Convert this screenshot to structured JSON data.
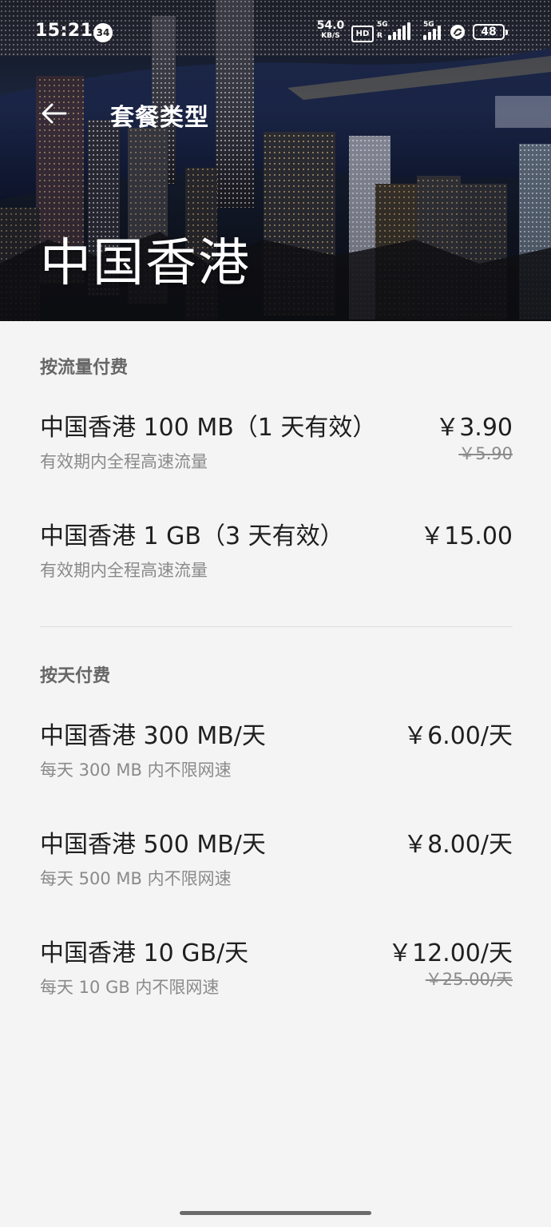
{
  "status_bar": {
    "time": "15:21",
    "notification_count": "34",
    "net_speed_value": "54.0",
    "net_speed_unit": "KB/S",
    "hd_label": "HD",
    "sim1_network": "5G",
    "sim1_roaming": "R",
    "sim2_network": "5G",
    "battery_level": "48"
  },
  "header": {
    "back_icon": "arrow-left-icon",
    "title": "套餐类型",
    "region": "中国香港"
  },
  "sections": [
    {
      "title": "按流量付费",
      "plans": [
        {
          "name": "中国香港 100 MB（1 天有效）",
          "description": "有效期内全程高速流量",
          "price": "￥3.90",
          "original_price": "￥5.90"
        },
        {
          "name": "中国香港 1 GB（3 天有效）",
          "description": "有效期内全程高速流量",
          "price": "￥15.00",
          "original_price": ""
        }
      ]
    },
    {
      "title": "按天付费",
      "plans": [
        {
          "name": "中国香港 300 MB/天",
          "description": "每天 300 MB 内不限网速",
          "price": "￥6.00/天",
          "original_price": ""
        },
        {
          "name": "中国香港 500 MB/天",
          "description": "每天 500 MB 内不限网速",
          "price": "￥8.00/天",
          "original_price": ""
        },
        {
          "name": "中国香港 10 GB/天",
          "description": "每天 10 GB 内不限网速",
          "price": "￥12.00/天",
          "original_price": "￥25.00/天"
        }
      ]
    }
  ],
  "colors": {
    "background": "#f4f4f4",
    "primary_text": "#1f1f1f",
    "secondary_text": "#8a8a8a",
    "section_title": "#666666"
  }
}
